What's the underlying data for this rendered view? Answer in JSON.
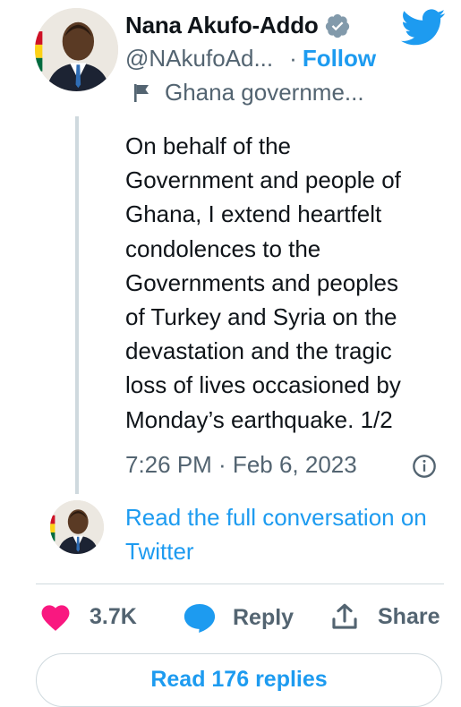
{
  "author": {
    "name": "Nana Akufo-Addo",
    "handle": "@NAkufoAd...",
    "follow_label": "Follow",
    "account_label": "Ghana governme...",
    "verified_icon": "verified-badge-icon"
  },
  "tweet": {
    "text": "On behalf of the\nGovernment and people of\nGhana, I extend heartfelt\ncondolences to the\nGovernments and peoples\nof Turkey and Syria on the\ndevastation and the tragic\nloss of lives occasioned by\nMonday’s earthquake. 1/2",
    "timestamp": "7:26 PM · Feb 6, 2023"
  },
  "conversation": {
    "link_label": "Read the full conversation on Twitter"
  },
  "actions": {
    "like_count": "3.7K",
    "reply_label": "Reply",
    "share_label": "Share"
  },
  "replies": {
    "button_label": "Read 176 replies"
  },
  "colors": {
    "accent": "#1d9bf0",
    "like": "#f91880",
    "text": "#0f1419",
    "muted": "#536471",
    "border": "#cfd9de"
  }
}
